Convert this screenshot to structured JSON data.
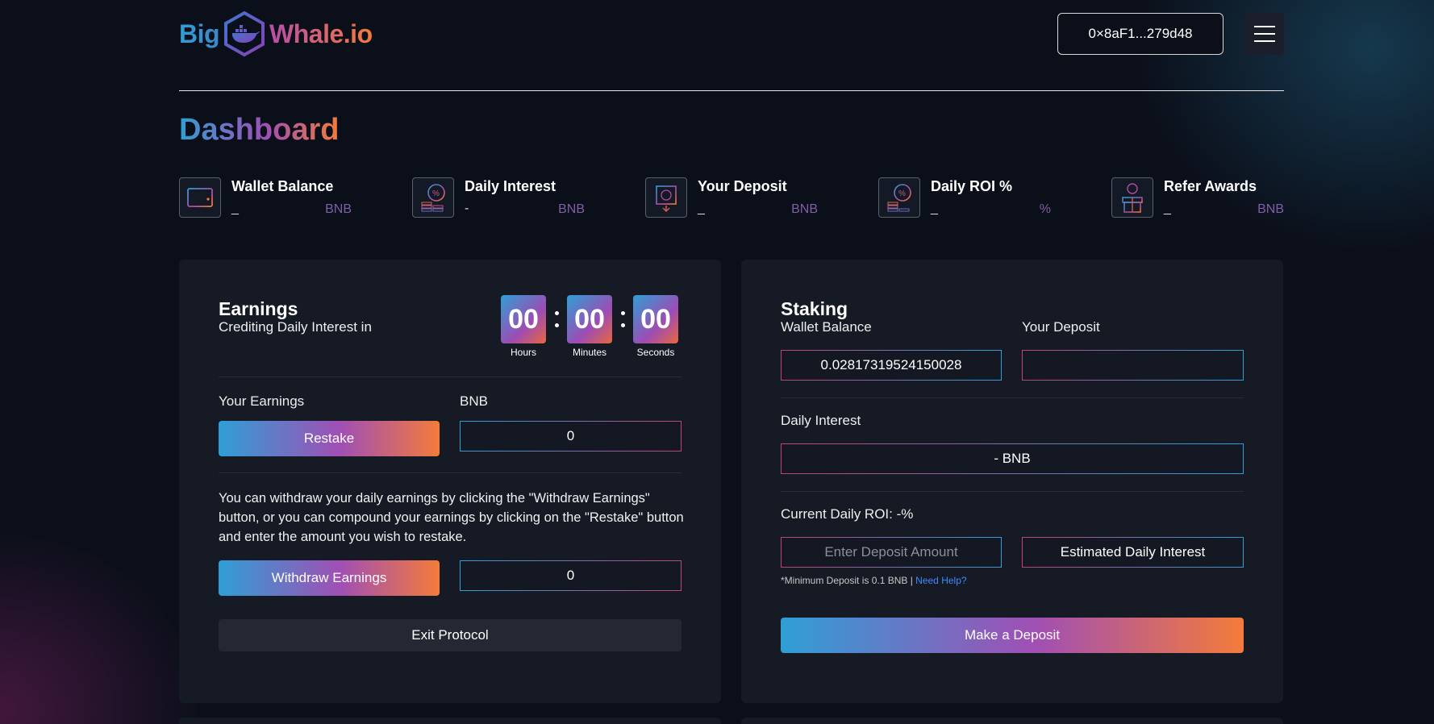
{
  "header": {
    "logo_left": "Big",
    "logo_right": "Whale.io",
    "wallet_address": "0×8aF1...279d48"
  },
  "page_title": "Dashboard",
  "stats": [
    {
      "label": "Wallet Balance",
      "value": "_",
      "unit": "BNB",
      "icon": "wallet-icon"
    },
    {
      "label": "Daily Interest",
      "value": "-",
      "unit": "BNB",
      "icon": "coins-percent-icon"
    },
    {
      "label": "Your Deposit",
      "value": "_",
      "unit": "BNB",
      "icon": "deposit-icon"
    },
    {
      "label": "Daily ROI %",
      "value": "_",
      "unit": "%",
      "icon": "roi-coins-icon"
    },
    {
      "label": "Refer Awards",
      "value": "_",
      "unit": "BNB",
      "icon": "gift-icon"
    }
  ],
  "earnings": {
    "title": "Earnings",
    "subtitle": "Crediting Daily Interest in",
    "timer": {
      "hours": "00",
      "minutes": "00",
      "seconds": "00",
      "hours_label": "Hours",
      "minutes_label": "Minutes",
      "seconds_label": "Seconds"
    },
    "your_earnings_label": "Your Earnings",
    "bnb_label": "BNB",
    "restake_label": "Restake",
    "restake_value": "0",
    "info_text": "You can withdraw your daily earnings by clicking the \"Withdraw Earnings\" button, or you can compound your earnings by clicking on the \"Restake\" button and enter the amount you wish to restake.",
    "withdraw_label": "Withdraw Earnings",
    "withdraw_value": "0",
    "exit_label": "Exit Protocol"
  },
  "staking": {
    "title": "Staking",
    "wallet_balance_label": "Wallet Balance",
    "wallet_balance_value": "0.02817319524150028",
    "your_deposit_label": "Your Deposit",
    "your_deposit_value": "",
    "daily_interest_label": "Daily Interest",
    "daily_interest_value": "- BNB",
    "current_roi_label": "Current Daily ROI: -%",
    "deposit_placeholder": "Enter Deposit Amount",
    "estimated_label": "Estimated Daily Interest",
    "min_note": "*Minimum Deposit is 0.1 BNB | ",
    "help_link": "Need Help?",
    "deposit_button": "Make a Deposit"
  }
}
